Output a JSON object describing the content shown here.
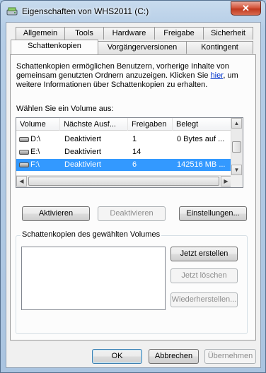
{
  "window": {
    "title": "Eigenschaften von WHS2011 (C:)",
    "close_label": "✕"
  },
  "tabs_row1": [
    "Allgemein",
    "Tools",
    "Hardware",
    "Freigabe",
    "Sicherheit"
  ],
  "tabs_row2": [
    "Schattenkopien",
    "Vorgängerversionen",
    "Kontingent"
  ],
  "description": {
    "text_before_link": "Schattenkopien ermöglichen Benutzern, vorherige Inhalte von gemeinsam genutzten Ordnern anzuzeigen. Klicken Sie ",
    "link": "hier",
    "text_after_link": ", um weitere Informationen über Schattenkopien zu erhalten."
  },
  "volume_select_label": "Wählen Sie ein Volume aus:",
  "volume_table": {
    "columns": [
      "Volume",
      "Nächste Ausf...",
      "Freigaben",
      "Belegt"
    ],
    "rows": [
      {
        "volume": "D:\\",
        "next_run": "Deaktiviert",
        "shares": "1",
        "used": "0 Bytes auf ..."
      },
      {
        "volume": "E:\\",
        "next_run": "Deaktiviert",
        "shares": "14",
        "used": ""
      },
      {
        "volume": "F:\\",
        "next_run": "Deaktiviert",
        "shares": "6",
        "used": "142516 MB ..."
      }
    ],
    "selected_index": 2
  },
  "volume_buttons": {
    "enable": "Aktivieren",
    "disable": "Deaktivieren",
    "settings": "Einstellungen..."
  },
  "snapshots_group": {
    "title": "Schattenkopien des gewählten Volumes",
    "create_now": "Jetzt erstellen",
    "delete_now": "Jetzt löschen",
    "restore": "Wiederherstellen..."
  },
  "footer": {
    "ok": "OK",
    "cancel": "Abbrechen",
    "apply": "Übernehmen"
  },
  "colors": {
    "selection": "#3399ff",
    "link": "#0033cc",
    "close_button": "#c03a20"
  }
}
